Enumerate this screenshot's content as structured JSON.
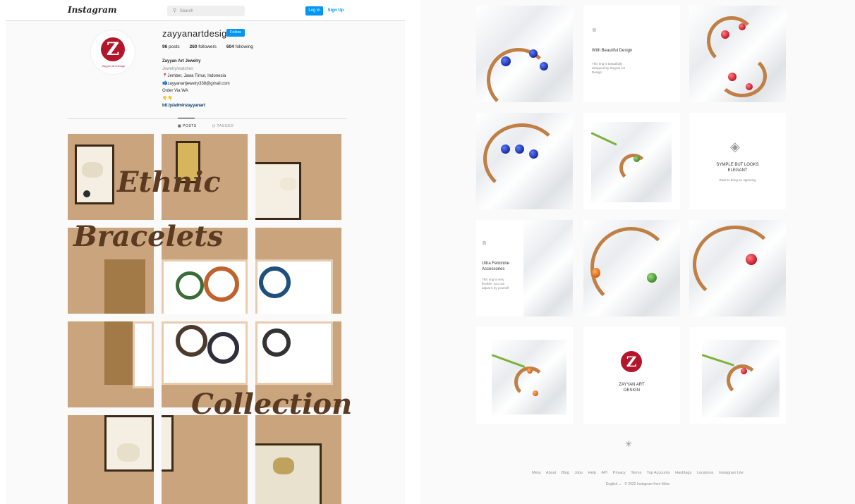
{
  "left": {
    "header": {
      "logo": "Instagram",
      "search_placeholder": "Search",
      "login_label": "Log in",
      "signup_label": "Sign Up"
    },
    "profile": {
      "username": "zayyanartdesign",
      "follow_label": "Follow",
      "avatar_sub": "Zayyan Art Design",
      "stats": {
        "posts_count": "96",
        "posts_label": "posts",
        "followers_count": "260",
        "followers_label": "followers",
        "following_count": "604",
        "following_label": "following"
      },
      "bio": {
        "name": "Zayyan Art Jewelry",
        "category": "Jewelry/watches",
        "location": "Jember, Jawa Timur, Indonesia",
        "email": "zayyanartjewelry338@gmail.com",
        "order": "Order Via WA",
        "emoji": "👇👇",
        "link": "bit.ly/adminzayyanart"
      }
    },
    "tabs": {
      "posts": "POSTS",
      "tagged": "TAGGED"
    },
    "grid_text": {
      "line1": "Ethnic",
      "line2": "Bracelets",
      "line3": "Collection"
    }
  },
  "right": {
    "cards": {
      "card1_title": "With Beautiful Design",
      "card1_body": "This ring is beautifully designed by Zayyan Art Design",
      "card2_title": "SYMPLE BUT LOOKS ELEGANT",
      "card2_body": "Want to bring an opposing",
      "card3_title": "Ultra Feminine Accessories",
      "card3_body": "This ring is very flexible, you can adjust it by yourself",
      "logo_text": "ZAYYAN ART DESIGN"
    },
    "footer": {
      "links": [
        "Meta",
        "About",
        "Blog",
        "Jobs",
        "Help",
        "API",
        "Privacy",
        "Terms",
        "Top Accounts",
        "Hashtags",
        "Locations",
        "Instagram Lite"
      ],
      "language": "English",
      "copyright": "© 2022 Instagram from Meta"
    }
  }
}
